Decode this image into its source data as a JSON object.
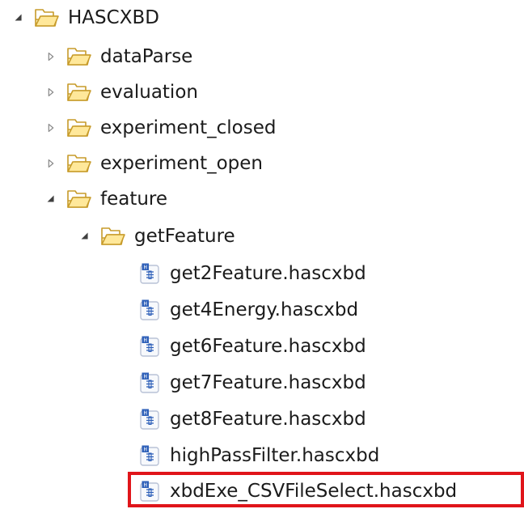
{
  "tree": {
    "root": {
      "label": "HASCXBD",
      "expanded": true
    },
    "folders": [
      {
        "label": "dataParse",
        "expanded": false
      },
      {
        "label": "evaluation",
        "expanded": false
      },
      {
        "label": "experiment_closed",
        "expanded": false
      },
      {
        "label": "experiment_open",
        "expanded": false
      },
      {
        "label": "feature",
        "expanded": true
      }
    ],
    "subfolder": {
      "label": "getFeature",
      "expanded": true
    },
    "files": [
      {
        "label": "get2Feature.hascxbd"
      },
      {
        "label": "get4Energy.hascxbd"
      },
      {
        "label": "get6Feature.hascxbd"
      },
      {
        "label": "get7Feature.hascxbd"
      },
      {
        "label": "get8Feature.hascxbd"
      },
      {
        "label": "highPassFilter.hascxbd"
      },
      {
        "label": "xbdExe_CSVFileSelect.hascxbd",
        "highlighted": true
      }
    ],
    "icons": {
      "folder": "folder-open-icon",
      "file": "hascxbd-file-icon",
      "expanded": "triangle-down-right-icon",
      "collapsed": "triangle-right-icon"
    },
    "colors": {
      "folder_fill": "#fff2b8",
      "folder_stroke": "#c79b2a",
      "highlight_border": "#e0151a",
      "file_blue": "#2d5fb8"
    }
  }
}
